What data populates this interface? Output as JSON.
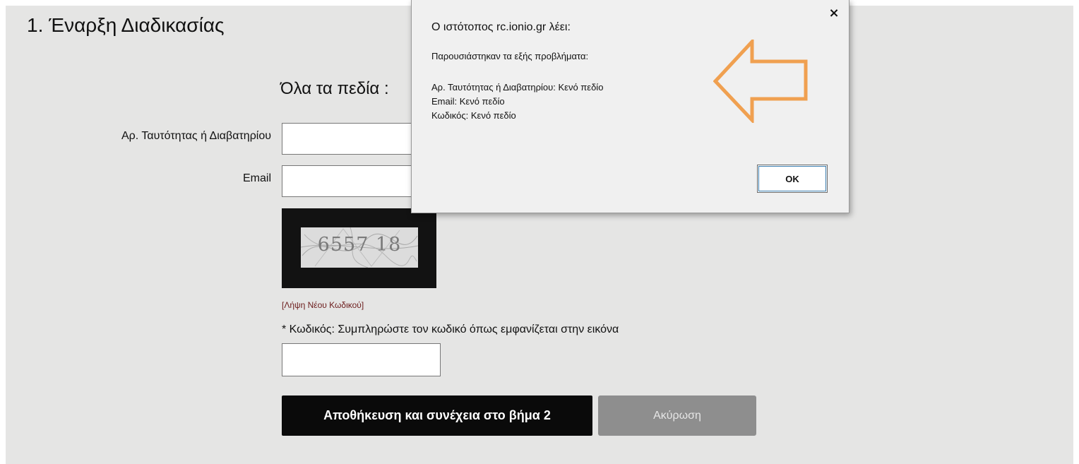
{
  "page": {
    "step_title": "1. Έναρξη Διαδικασίας",
    "required_note": "Όλα τα πεδία :"
  },
  "form": {
    "id_label": "Αρ. Ταυτότητας ή Διαβατηρίου",
    "id_value": "",
    "email_label": "Email",
    "email_value": "",
    "captcha_code": "6557 18",
    "new_code_link": "[Λήψη Νέου Κωδικού]",
    "code_instruction": "* Κωδικός: Συμπληρώστε τον κωδικό όπως εμφανίζεται στην εικόνα",
    "code_value": "",
    "save_button": "Αποθήκευση και συνέχεια στο βήμα 2",
    "cancel_button": "Ακύρωση"
  },
  "dialog": {
    "title": "Ο ιστότοπος rc.ionio.gr λέει:",
    "intro": "Παρουσιάστηκαν τα εξής προβλήματα:",
    "errors": [
      "Αρ. Ταυτότητας ή Διαβατηρίου: Κενό πεδίο",
      "Email: Κενό πεδίο",
      "Κωδικός: Κενό πεδίο"
    ],
    "ok_button": "OK",
    "close_glyph": "×"
  },
  "colors": {
    "page_background": "#e5e5e4",
    "save_button_bg": "#0a0a0a",
    "cancel_button_bg": "#8e8e8e",
    "arrow_outline": "#f0a050",
    "link": "#6b1b1b"
  },
  "icons": {
    "close": "close-icon",
    "annotation_arrow": "left-arrow-icon"
  }
}
